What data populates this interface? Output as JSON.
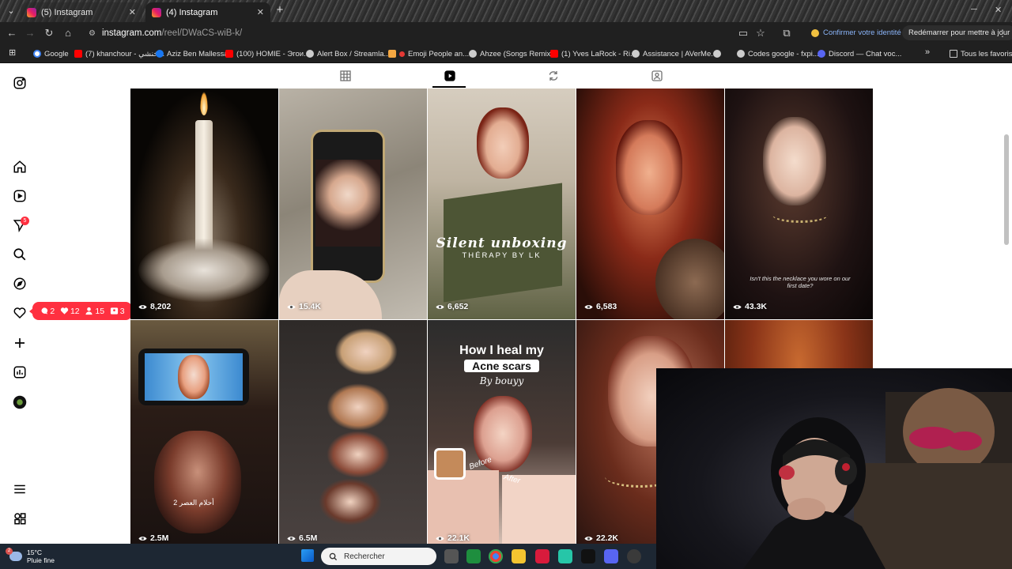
{
  "browser": {
    "tabs": [
      {
        "title": "(5) Instagram",
        "active": false
      },
      {
        "title": "(4) Instagram",
        "active": true
      }
    ],
    "url_host": "instagram.com",
    "url_path": "/reel/DWaCS-wiB-k/",
    "identity_label": "Confirmer votre identité",
    "restart_label": "Redémarrer pour mettre à jour",
    "bookmarks": [
      {
        "label": "Google",
        "color": "#4285f4"
      },
      {
        "label": "(7) khanchour - خنشي...",
        "color": "#ff0000"
      },
      {
        "label": "Aziz Ben Mallessa",
        "color": "#1877f2"
      },
      {
        "label": "(100) HOMIE - Эгои...",
        "color": "#ff0000"
      },
      {
        "label": "Alert Box / Streamla...",
        "color": "#cccccc"
      },
      {
        "label": "Emoji People an...",
        "color": "#f4a742"
      },
      {
        "label": "Ahzee (Songs Remix...",
        "color": "#cccccc"
      },
      {
        "label": "(1) Yves LaRock - Ri...",
        "color": "#ff0000"
      },
      {
        "label": "Assistance | AVerMe...",
        "color": "#cccccc"
      },
      {
        "label": "",
        "color": "#cccccc"
      },
      {
        "label": "Codes google - fxpi...",
        "color": "#cccccc"
      },
      {
        "label": "Discord — Chat voc...",
        "color": "#5865f2"
      }
    ],
    "all_bookmarks_label": "Tous les favoris"
  },
  "sidebar": {
    "messages_badge": "5",
    "notifications": {
      "comments": "2",
      "likes": "12",
      "follows": "15",
      "tags": "3"
    }
  },
  "grid": [
    {
      "views": "8,202",
      "overlay": ""
    },
    {
      "views": "15.4K",
      "overlay": ""
    },
    {
      "views": "6,652",
      "overlay": "Silent unboxing",
      "overlay_sub": "THÉRAPY BY LK"
    },
    {
      "views": "6,583",
      "overlay": ""
    },
    {
      "views": "43.3K",
      "overlay": "Isn't this the necklace you wore on our first date?"
    },
    {
      "views": "2.5M",
      "overlay": "أحلام العصر 2"
    },
    {
      "views": "6.5M",
      "overlay": ""
    },
    {
      "views": "22.1K",
      "overlay": "How I heal my",
      "overlay_hl": "Acne scars",
      "overlay_by": "By bouyy",
      "before": "Before",
      "after": "After"
    },
    {
      "views": "22.2K",
      "overlay": ""
    }
  ],
  "taskbar": {
    "weather_temp": "15°C",
    "weather_desc": "Pluie fine",
    "weather_badge": "2",
    "search_placeholder": "Rechercher"
  }
}
